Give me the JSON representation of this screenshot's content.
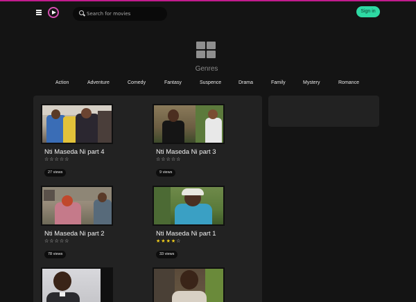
{
  "header": {
    "search_placeholder": "Search for movies",
    "signin_label": "Sign in",
    "accent_color": "#c21c8e",
    "signin_color": "#2ed9a3"
  },
  "genres": {
    "title": "Genres",
    "items": [
      "Action",
      "Adventure",
      "Comedy",
      "Fantasy",
      "Suspence",
      "Drama",
      "Family",
      "Mystery",
      "Romance"
    ]
  },
  "movies": [
    {
      "title": "Nti Maseda Ni part 4",
      "rating": 0,
      "views": "27 views"
    },
    {
      "title": "Nti Maseda Ni part 3",
      "rating": 0,
      "views": "9 views"
    },
    {
      "title": "Nti Maseda Ni part 2",
      "rating": 0,
      "views": "78 views"
    },
    {
      "title": "Nti Maseda Ni part 1",
      "rating": 4,
      "views": "33 views"
    },
    {
      "title": "",
      "rating": 0,
      "views": ""
    },
    {
      "title": "",
      "rating": 0,
      "views": ""
    }
  ]
}
